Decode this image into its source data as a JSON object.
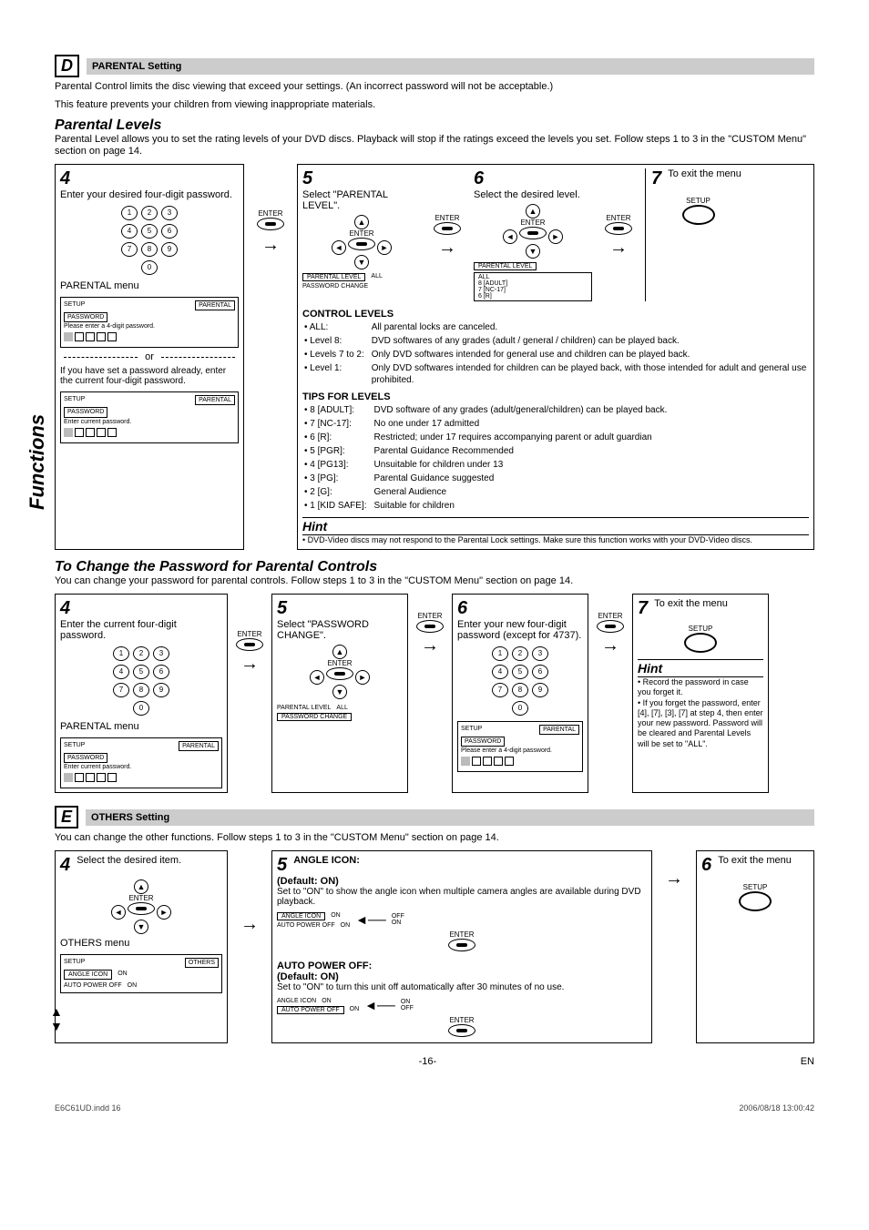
{
  "sidebar": "Functions",
  "sectionD": {
    "badge": "D",
    "title": "PARENTAL Setting",
    "intro1": "Parental Control limits the disc viewing that exceed your settings. (An incorrect password will not be acceptable.)",
    "intro2": "This feature prevents your children from viewing inappropriate materials.",
    "heading": "Parental Levels",
    "desc": "Parental Level allows you to set the rating levels of your DVD discs. Playback will stop if the ratings exceed the levels you set. Follow steps 1 to 3 in the \"CUSTOM Menu\" section on page 14.",
    "step4": {
      "n": "4",
      "text": "Enter your desired four-digit password.",
      "menuLabel": "PARENTAL menu",
      "or": "or",
      "altText": "If you have set a password already, enter the current four-digit password.",
      "screen1": {
        "setup": "SETUP",
        "tab": "PARENTAL",
        "row1": "PASSWORD",
        "row2": "Please enter a 4-digit password."
      },
      "screen2": {
        "setup": "SETUP",
        "tab": "PARENTAL",
        "row1": "PASSWORD",
        "row2": "Enter current password."
      },
      "enterLabel": "ENTER"
    },
    "step5": {
      "n": "5",
      "text": "Select \"PARENTAL LEVEL\".",
      "enterLabel": "ENTER",
      "opt1": "PARENTAL LEVEL",
      "opt1v": "ALL",
      "opt2": "PASSWORD CHANGE"
    },
    "step6": {
      "n": "6",
      "text": "Select the desired level.",
      "enterLabel": "ENTER",
      "opt": "PARENTAL LEVEL",
      "vals": [
        "ALL",
        "8 [ADULT]",
        "7 [NC-17]",
        "6 [R]"
      ]
    },
    "step7": {
      "n": "7",
      "text": "To exit the menu",
      "btn": "SETUP"
    },
    "controlHead": "CONTROL LEVELS",
    "controls": [
      {
        "k": "• ALL:",
        "v": "All parental locks are canceled."
      },
      {
        "k": "• Level 8:",
        "v": "DVD softwares of any grades (adult / general / children) can be played back."
      },
      {
        "k": "• Levels 7 to 2:",
        "v": "Only DVD softwares intended for general use and children can be played back."
      },
      {
        "k": "• Level 1:",
        "v": "Only DVD softwares intended for children can be played back, with those intended for adult and general use prohibited."
      }
    ],
    "tipsHead": "TIPS FOR LEVELS",
    "tips": [
      {
        "k": "• 8 [ADULT]:",
        "v": "DVD software of any grades (adult/general/children) can be played back."
      },
      {
        "k": "• 7 [NC-17]:",
        "v": "No one under 17 admitted"
      },
      {
        "k": "• 6 [R]:",
        "v": "Restricted; under 17 requires accompanying parent or adult guardian"
      },
      {
        "k": "• 5 [PGR]:",
        "v": "Parental Guidance Recommended"
      },
      {
        "k": "• 4 [PG13]:",
        "v": "Unsuitable for children under 13"
      },
      {
        "k": "• 3 [PG]:",
        "v": "Parental Guidance suggested"
      },
      {
        "k": "• 2 [G]:",
        "v": "General Audience"
      },
      {
        "k": "• 1 [KID SAFE]:",
        "v": "Suitable for children"
      }
    ],
    "hintHead": "Hint",
    "hint": "• DVD-Video discs may not respond to the Parental Lock settings. Make sure this function works with your DVD-Video discs."
  },
  "changePw": {
    "heading": "To Change the Password for Parental Controls",
    "desc": "You can change your password for parental controls.  Follow steps 1 to 3 in the \"CUSTOM Menu\" section on page 14.",
    "step4": {
      "n": "4",
      "text": "Enter the current four-digit password.",
      "menuLabel": "PARENTAL menu",
      "enterLabel": "ENTER",
      "screen": {
        "setup": "SETUP",
        "tab": "PARENTAL",
        "row1": "PASSWORD",
        "row2": "Enter current password."
      }
    },
    "step5": {
      "n": "5",
      "text": "Select \"PASSWORD CHANGE\".",
      "enterLabel": "ENTER",
      "opt1": "PARENTAL LEVEL",
      "opt1v": "ALL",
      "opt2": "PASSWORD CHANGE"
    },
    "step6": {
      "n": "6",
      "text": "Enter your new four-digit password (except for 4737).",
      "enterLabel": "ENTER",
      "screen": {
        "setup": "SETUP",
        "tab": "PARENTAL",
        "row1": "PASSWORD",
        "row2": "Please enter a 4-digit password."
      }
    },
    "step7": {
      "n": "7",
      "text": "To exit the menu",
      "btn": "SETUP"
    },
    "hintHead": "Hint",
    "hint1": "• Record the password in case you forget it.",
    "hint2": "• If you forget the password, enter [4], [7], [3], [7] at step 4, then enter your new password. Password will be cleared and Parental Levels will be set to \"ALL\"."
  },
  "sectionE": {
    "badge": "E",
    "title": "OTHERS Setting",
    "desc": "You can change the other functions. Follow steps 1 to 3 in the \"CUSTOM Menu\" section on page 14.",
    "step4": {
      "n": "4",
      "text": "Select the desired item.",
      "menuLabel": "OTHERS menu",
      "enter": "ENTER",
      "screen": {
        "setup": "SETUP",
        "tab": "OTHERS",
        "r1": "ANGLE ICON",
        "v1": "ON",
        "r2": "AUTO POWER OFF",
        "v2": "ON"
      }
    },
    "step5": {
      "n": "5",
      "a_title": "ANGLE ICON:",
      "a_def": "(Default: ON)",
      "a_desc": "Set to \"ON\" to show the angle icon when multiple camera angles are available during DVD playback.",
      "a_opts": {
        "r1": "ANGLE ICON",
        "v1": "ON",
        "r2": "AUTO POWER OFF",
        "v2": "ON",
        "side1": "OFF",
        "side2": "ON"
      },
      "b_title": "AUTO POWER OFF:",
      "b_def": "(Default: ON)",
      "b_desc": "Set to \"ON\" to turn this unit off automatically after 30 minutes of no use.",
      "b_opts": {
        "r1": "ANGLE ICON",
        "v1": "ON",
        "r2": "AUTO POWER OFF",
        "v2": "ON",
        "side1": "ON",
        "side2": "OFF"
      },
      "enter": "ENTER"
    },
    "step6": {
      "n": "6",
      "text": "To exit the menu",
      "btn": "SETUP"
    }
  },
  "footer": {
    "page": "-16-",
    "lang": "EN"
  },
  "docfoot": {
    "file": "E6C61UD.indd   16",
    "stamp": "2006/08/18   13:00:42"
  }
}
